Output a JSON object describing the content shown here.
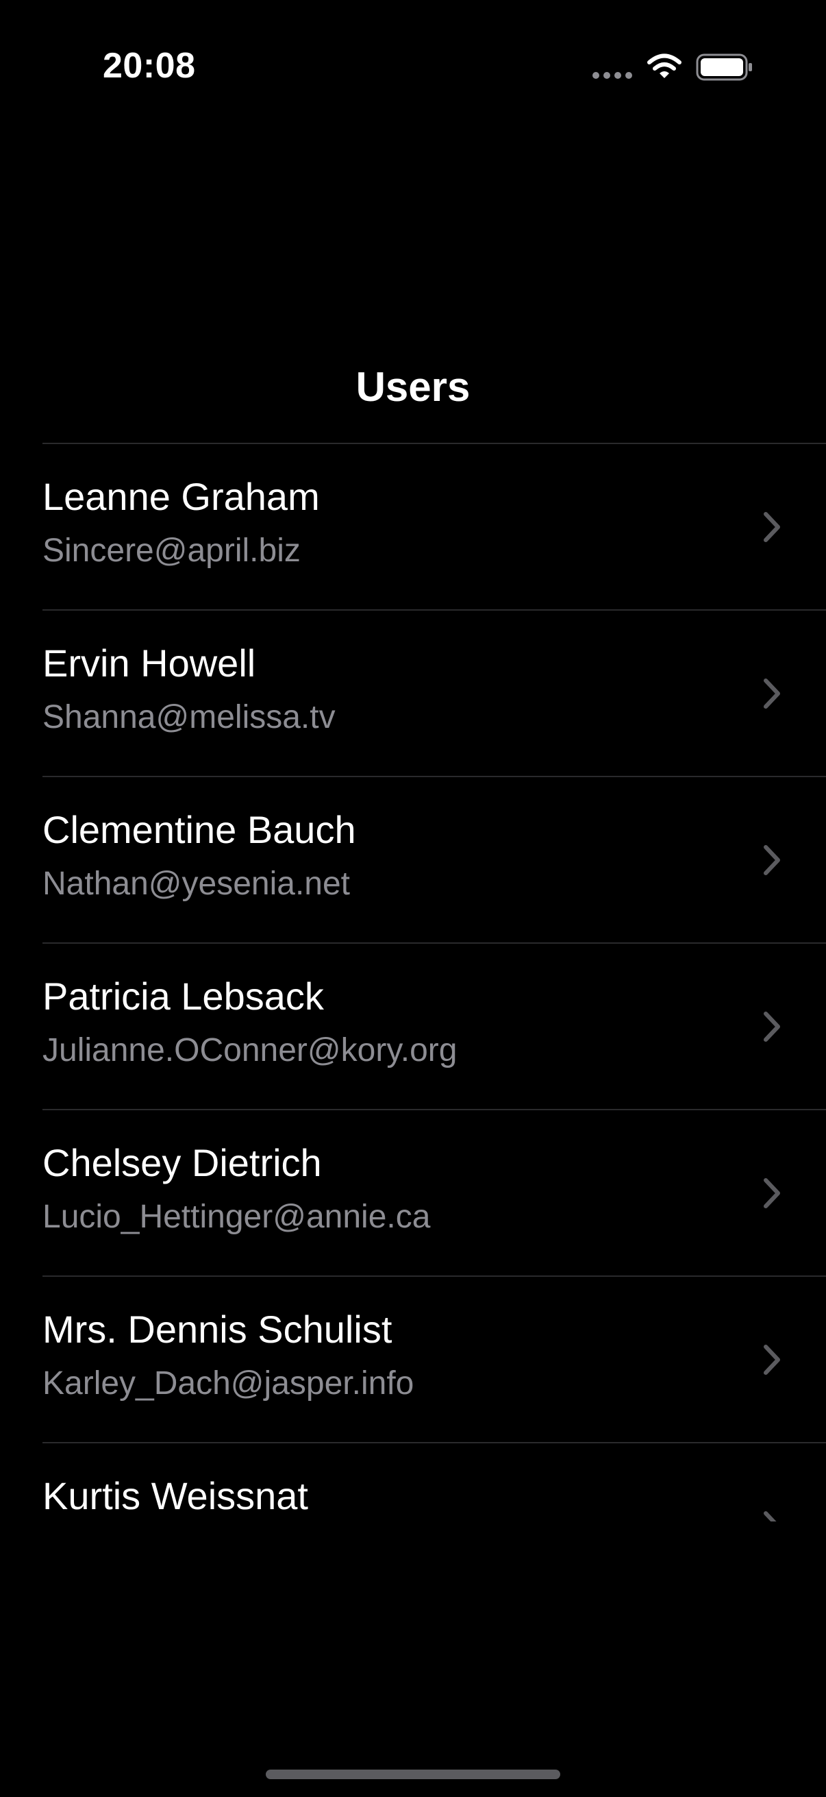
{
  "status_bar": {
    "time": "20:08",
    "icons": [
      "signal-dots-icon",
      "wifi-icon",
      "battery-icon"
    ]
  },
  "nav": {
    "title": "Users"
  },
  "users": [
    {
      "name": "Leanne Graham",
      "email": "Sincere@april.biz"
    },
    {
      "name": "Ervin Howell",
      "email": "Shanna@melissa.tv"
    },
    {
      "name": "Clementine Bauch",
      "email": "Nathan@yesenia.net"
    },
    {
      "name": "Patricia Lebsack",
      "email": "Julianne.OConner@kory.org"
    },
    {
      "name": "Chelsey Dietrich",
      "email": "Lucio_Hettinger@annie.ca"
    },
    {
      "name": "Mrs. Dennis Schulist",
      "email": "Karley_Dach@jasper.info"
    },
    {
      "name": "Kurtis Weissnat",
      "email": ""
    }
  ],
  "colors": {
    "background": "#000000",
    "primary_text": "#ffffff",
    "secondary_text": "#8d8d93",
    "separator": "#2a2a2c",
    "chevron": "#5b5b5f"
  }
}
